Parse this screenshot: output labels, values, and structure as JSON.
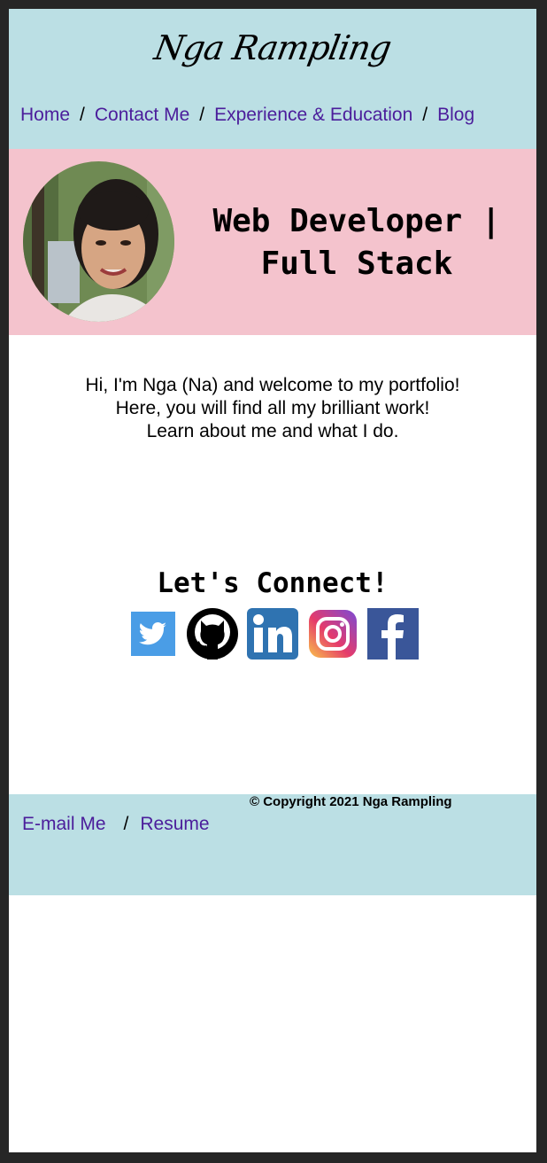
{
  "header": {
    "logo_text": "Nga Rampling",
    "nav": [
      {
        "label": "Home"
      },
      {
        "label": "Contact Me"
      },
      {
        "label": "Experience & Education"
      },
      {
        "label": "Blog"
      }
    ],
    "separator": "/"
  },
  "hero": {
    "title_line1": "Web Developer |",
    "title_line2": "Full Stack",
    "avatar_icon": "profile-photo"
  },
  "intro": {
    "line1": "Hi, I'm Nga (Na) and welcome to my portfolio!",
    "line2": "Here, you will find all my brilliant work!",
    "line3": "Learn about me and what I do."
  },
  "connect": {
    "heading": "Let's Connect!",
    "icons": [
      "twitter-icon",
      "github-icon",
      "linkedin-icon",
      "instagram-icon",
      "facebook-icon"
    ]
  },
  "footer": {
    "copyright": "© Copyright 2021 Nga Rampling",
    "links": [
      {
        "label": "E-mail Me"
      },
      {
        "label": "Resume"
      }
    ],
    "separator": "/"
  },
  "colors": {
    "header_bg": "#bbdfe4",
    "hero_bg": "#f4c3cd",
    "link": "#4b1d9b",
    "twitter": "#4a9de6",
    "linkedin": "#2f73b1",
    "facebook": "#3a5699"
  }
}
